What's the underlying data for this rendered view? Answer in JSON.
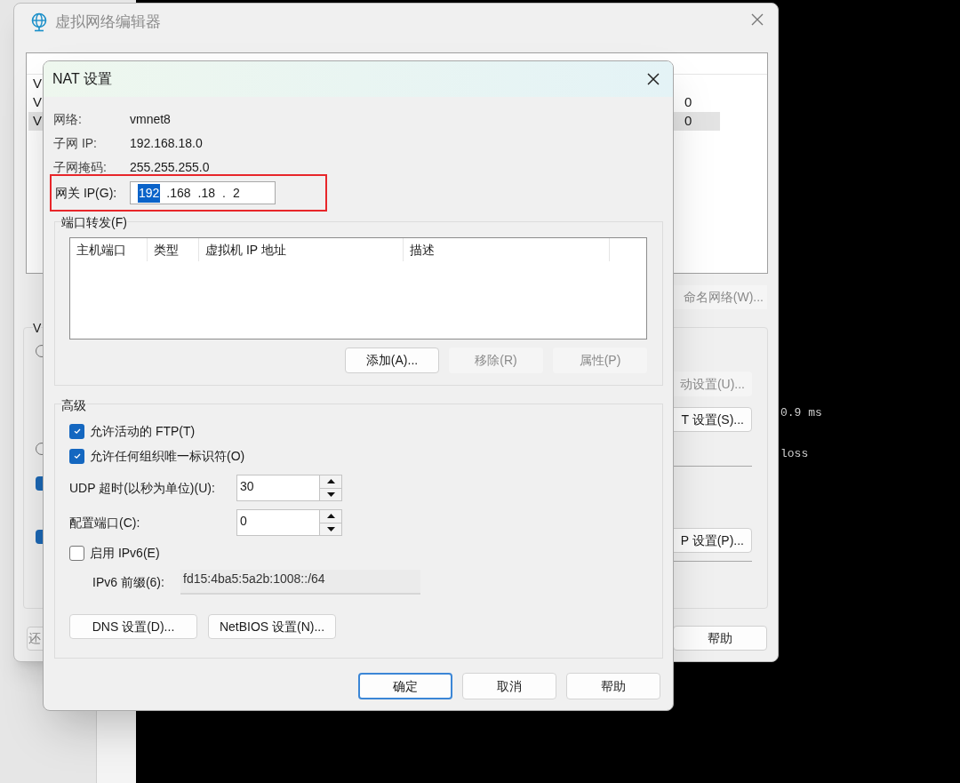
{
  "terminal": {
    "lines": [
      "0.9 ms",
      "loss"
    ]
  },
  "editor_window": {
    "title": "虚拟网络编辑器",
    "rows": [
      {
        "name": "V",
        "selected": false
      },
      {
        "name": "V",
        "subnet": "0",
        "selected": false
      },
      {
        "name": "V",
        "subnet": "0",
        "selected": true
      }
    ],
    "rename_button": "命名网络(W)...",
    "group_label": "V",
    "left_controls": [
      {
        "kind": "radio",
        "checked": false
      },
      {
        "kind": "radio",
        "checked": false
      },
      {
        "kind": "checkbox",
        "checked": true
      },
      {
        "kind": "checkbox",
        "checked": true
      }
    ],
    "side_buttons": [
      {
        "label": "动设置(U)...",
        "disabled": true
      },
      {
        "label": "T 设置(S)...",
        "disabled": false
      },
      {
        "label": "P 设置(P)...",
        "disabled": false
      }
    ],
    "footer_left": "还",
    "footer_right": "帮助"
  },
  "nat_dialog": {
    "title": "NAT 设置",
    "info": [
      {
        "label": "网络:",
        "value": "vmnet8"
      },
      {
        "label": "子网 IP:",
        "value": "192.168.18.0"
      },
      {
        "label": "子网掩码:",
        "value": "255.255.255.0"
      }
    ],
    "gateway": {
      "label": "网关 IP(G):",
      "octets": [
        {
          "text": "192",
          "selected": true
        },
        {
          "text": ".168",
          "selected": false
        },
        {
          "text": ".18",
          "selected": false
        },
        {
          "text": ".",
          "selected": false
        },
        {
          "text": "2",
          "selected": false
        }
      ]
    },
    "port_forwarding": {
      "label": "端口转发(F)",
      "columns": [
        "主机端口",
        "类型",
        "虚拟机 IP 地址",
        "描述"
      ],
      "buttons": [
        {
          "label": "添加(A)...",
          "disabled": false
        },
        {
          "label": "移除(R)",
          "disabled": true
        },
        {
          "label": "属性(P)",
          "disabled": true
        }
      ]
    },
    "advanced": {
      "label": "高级",
      "checkboxes": [
        {
          "label": "允许活动的 FTP(T)",
          "checked": true
        },
        {
          "label": "允许任何组织唯一标识符(O)",
          "checked": true
        }
      ],
      "spinners": [
        {
          "label": "UDP 超时(以秒为单位)(U):",
          "value": "30"
        },
        {
          "label": "配置端口(C):",
          "value": "0"
        }
      ],
      "ipv6": {
        "label": "启用 IPv6(E)",
        "checked": false
      },
      "prefix": {
        "label": "IPv6 前缀(6):",
        "value": "fd15:4ba5:5a2b:1008::/64",
        "disabled": true
      },
      "buttons": [
        "DNS 设置(D)...",
        "NetBIOS 设置(N)..."
      ]
    },
    "footer": [
      {
        "label": "确定",
        "default": true
      },
      {
        "label": "取消",
        "default": false
      },
      {
        "label": "帮助",
        "default": false
      }
    ]
  }
}
